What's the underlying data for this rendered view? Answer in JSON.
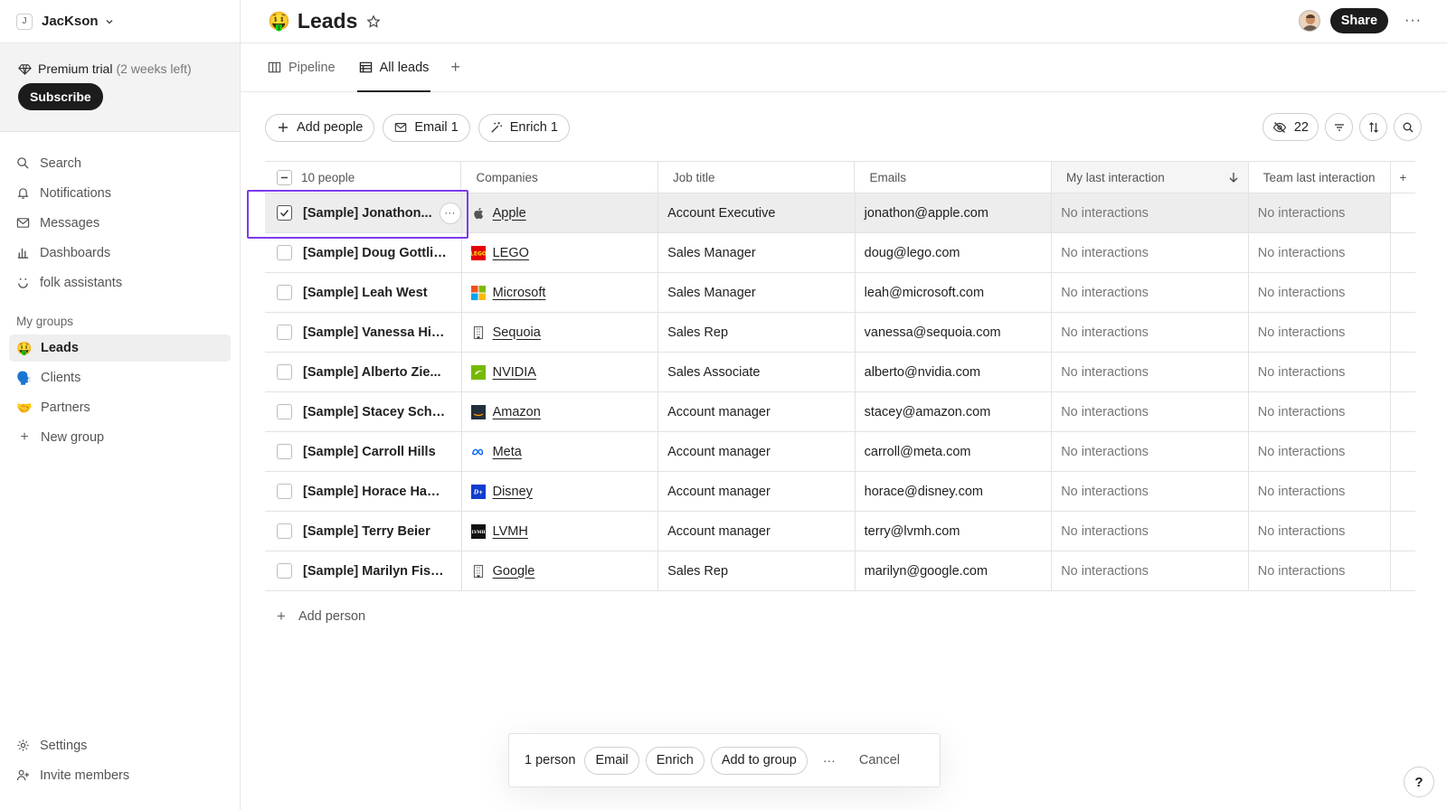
{
  "workspace": {
    "initial": "J",
    "name": "JacKson"
  },
  "trial": {
    "label": "Premium trial",
    "remaining": "(2 weeks left)",
    "subscribe": "Subscribe"
  },
  "nav": [
    {
      "label": "Search",
      "icon": "search-icon"
    },
    {
      "label": "Notifications",
      "icon": "bell-icon"
    },
    {
      "label": "Messages",
      "icon": "mail-icon"
    },
    {
      "label": "Dashboards",
      "icon": "chart-icon"
    },
    {
      "label": "folk assistants",
      "icon": "assistant-icon"
    }
  ],
  "groups": {
    "label": "My groups",
    "items": [
      {
        "emoji": "🤑",
        "label": "Leads",
        "active": true
      },
      {
        "emoji": "🗣️",
        "label": "Clients",
        "active": false
      },
      {
        "emoji": "🤝",
        "label": "Partners",
        "active": false
      }
    ],
    "new_group": "New group"
  },
  "bottom_nav": [
    {
      "label": "Settings",
      "icon": "gear-icon"
    },
    {
      "label": "Invite members",
      "icon": "add-user-icon"
    }
  ],
  "header": {
    "emoji": "🤑",
    "title": "Leads",
    "share": "Share"
  },
  "tabs": [
    {
      "label": "Pipeline",
      "icon": "kanban-icon",
      "active": false
    },
    {
      "label": "All leads",
      "icon": "table-icon",
      "active": true
    }
  ],
  "toolbar": {
    "add_people": "Add people",
    "email": "Email 1",
    "enrich": "Enrich 1",
    "hidden_count": "22"
  },
  "table": {
    "columns": {
      "people": "10 people",
      "companies": "Companies",
      "job": "Job title",
      "emails": "Emails",
      "my_last": "My last interaction",
      "team_last": "Team last interaction"
    },
    "rows": [
      {
        "name": "[Sample] Jonathon...",
        "company": "Apple",
        "logo": "apple",
        "job": "Account Executive",
        "email": "jonathon@apple.com",
        "my": "No interactions",
        "team": "No interactions"
      },
      {
        "name": "[Sample] Doug Gottlieb",
        "company": "LEGO",
        "logo": "lego",
        "job": "Sales Manager",
        "email": "doug@lego.com",
        "my": "No interactions",
        "team": "No interactions"
      },
      {
        "name": "[Sample] Leah West",
        "company": "Microsoft",
        "logo": "microsoft",
        "job": "Sales Manager",
        "email": "leah@microsoft.com",
        "my": "No interactions",
        "team": "No interactions"
      },
      {
        "name": "[Sample] Vanessa Hic...",
        "company": "Sequoia",
        "logo": "building",
        "job": "Sales Rep",
        "email": "vanessa@sequoia.com",
        "my": "No interactions",
        "team": "No interactions"
      },
      {
        "name": "[Sample] Alberto Zie...",
        "company": "NVIDIA",
        "logo": "nvidia",
        "job": "Sales Associate",
        "email": "alberto@nvidia.com",
        "my": "No interactions",
        "team": "No interactions"
      },
      {
        "name": "[Sample] Stacey Schu...",
        "company": "Amazon",
        "logo": "amazon",
        "job": "Account manager",
        "email": "stacey@amazon.com",
        "my": "No interactions",
        "team": "No interactions"
      },
      {
        "name": "[Sample] Carroll Hills",
        "company": "Meta",
        "logo": "meta",
        "job": "Account manager",
        "email": "carroll@meta.com",
        "my": "No interactions",
        "team": "No interactions"
      },
      {
        "name": "[Sample] Horace Hamill",
        "company": "Disney",
        "logo": "disney",
        "job": "Account manager",
        "email": "horace@disney.com",
        "my": "No interactions",
        "team": "No interactions"
      },
      {
        "name": "[Sample] Terry Beier",
        "company": "LVMH",
        "logo": "lvmh",
        "job": "Account manager",
        "email": "terry@lvmh.com",
        "my": "No interactions",
        "team": "No interactions"
      },
      {
        "name": "[Sample] Marilyn Fisher",
        "company": "Google",
        "logo": "building",
        "job": "Sales Rep",
        "email": "marilyn@google.com",
        "my": "No interactions",
        "team": "No interactions"
      }
    ],
    "add_person": "Add person"
  },
  "bulk": {
    "count": "1 person",
    "email": "Email",
    "enrich": "Enrich",
    "add_to_group": "Add to group",
    "more": "···",
    "cancel": "Cancel"
  },
  "help": "?",
  "colors": {
    "selection_outline": "#7c3aed",
    "accent_dark": "#1c1c1c"
  }
}
